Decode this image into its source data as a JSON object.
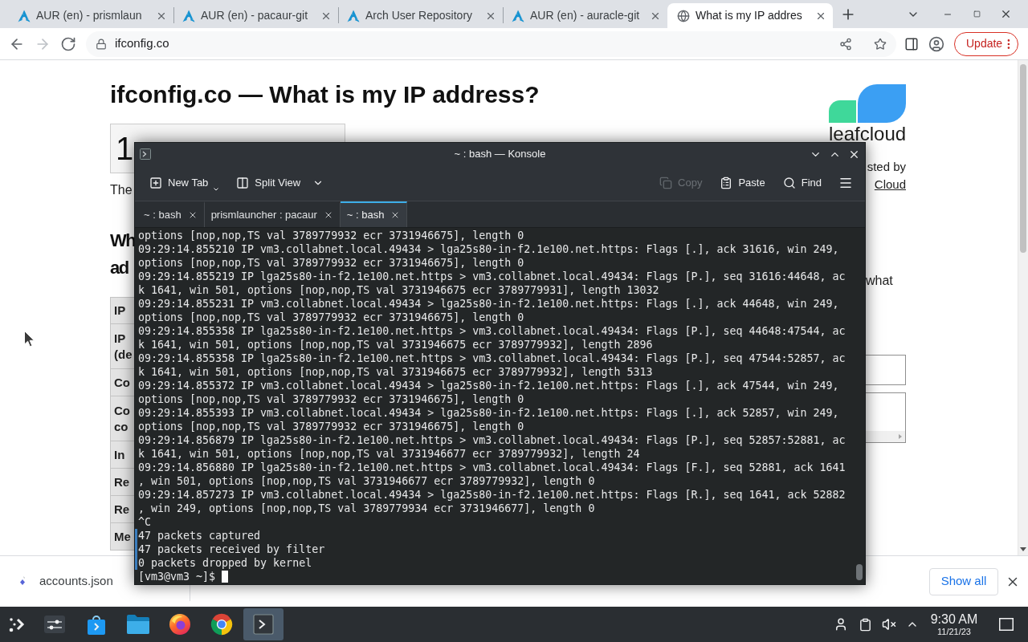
{
  "browser": {
    "tabs": [
      {
        "title": "AUR (en) - prismlaun",
        "kind": "logo",
        "selected": false
      },
      {
        "title": "AUR (en) - pacaur-git",
        "kind": "logo",
        "selected": false
      },
      {
        "title": "Arch User Repository",
        "kind": "logo",
        "selected": false
      },
      {
        "title": "AUR (en) - auracle-git",
        "kind": "logo",
        "selected": false
      },
      {
        "title": "What is my IP addres",
        "kind": "globe",
        "selected": true
      }
    ],
    "nav": [
      {
        "kind": "back",
        "disabled": false
      },
      {
        "kind": "forward",
        "disabled": true
      },
      {
        "kind": "reload",
        "disabled": false
      }
    ],
    "address": "ifconfig.co",
    "update_label": "Update"
  },
  "page": {
    "title": "ifconfig.co — What is my IP address?",
    "ip_address": "1",
    "intro": "The",
    "heading_lines": [
      "Wh",
      "ad"
    ],
    "table_rows": [
      {
        "lines": [
          "IP"
        ]
      },
      {
        "lines": [
          "IP",
          "(de"
        ]
      },
      {
        "lines": [
          "Co"
        ]
      },
      {
        "lines": [
          "Co",
          "co"
        ]
      },
      {
        "lines": [
          "In"
        ]
      },
      {
        "lines": [
          "Re"
        ]
      },
      {
        "lines": [
          "Re"
        ]
      },
      {
        "lines": [
          "Me"
        ]
      }
    ],
    "sponsor": {
      "logo_text": "leafcloud",
      "text": "sted by",
      "link": "Cloud"
    },
    "side_text": "what"
  },
  "downloads": {
    "items": [
      {
        "file": "accounts.json"
      }
    ],
    "show_all": "Show all"
  },
  "konsole": {
    "title": "~ : bash — Konsole",
    "toolbar": [
      {
        "label": "New Tab",
        "kind": "newtab",
        "disabled": false
      },
      {
        "label": "Split View",
        "kind": "split",
        "disabled": false
      },
      {
        "label": "Copy",
        "kind": "copy",
        "disabled": true
      },
      {
        "label": "Paste",
        "kind": "paste",
        "disabled": false
      },
      {
        "label": "Find",
        "kind": "find",
        "disabled": false
      }
    ],
    "tabs": [
      {
        "label": "~ : bash",
        "selected": false
      },
      {
        "label": "prismlauncher : pacaur",
        "selected": false
      },
      {
        "label": "~ : bash",
        "selected": true
      }
    ],
    "lines": [
      {
        "text": "options [nop,nop,TS val 3789779932 ecr 3731946675], length 0",
        "marked": false
      },
      {
        "text": "09:29:14.855210 IP vm3.collabnet.local.49434 > lga25s80-in-f2.1e100.net.https: Flags [.], ack 31616, win 249,",
        "marked": false
      },
      {
        "text": "options [nop,nop,TS val 3789779932 ecr 3731946675], length 0",
        "marked": false
      },
      {
        "text": "09:29:14.855219 IP lga25s80-in-f2.1e100.net.https > vm3.collabnet.local.49434: Flags [P.], seq 31616:44648, ac",
        "marked": false
      },
      {
        "text": "k 1641, win 501, options [nop,nop,TS val 3731946675 ecr 3789779931], length 13032",
        "marked": false
      },
      {
        "text": "09:29:14.855231 IP vm3.collabnet.local.49434 > lga25s80-in-f2.1e100.net.https: Flags [.], ack 44648, win 249,",
        "marked": false
      },
      {
        "text": "options [nop,nop,TS val 3789779932 ecr 3731946675], length 0",
        "marked": false
      },
      {
        "text": "09:29:14.855358 IP lga25s80-in-f2.1e100.net.https > vm3.collabnet.local.49434: Flags [P.], seq 44648:47544, ac",
        "marked": false
      },
      {
        "text": "k 1641, win 501, options [nop,nop,TS val 3731946675 ecr 3789779932], length 2896",
        "marked": false
      },
      {
        "text": "09:29:14.855358 IP lga25s80-in-f2.1e100.net.https > vm3.collabnet.local.49434: Flags [P.], seq 47544:52857, ac",
        "marked": false
      },
      {
        "text": "k 1641, win 501, options [nop,nop,TS val 3731946675 ecr 3789779932], length 5313",
        "marked": false
      },
      {
        "text": "09:29:14.855372 IP vm3.collabnet.local.49434 > lga25s80-in-f2.1e100.net.https: Flags [.], ack 47544, win 249,",
        "marked": false
      },
      {
        "text": "options [nop,nop,TS val 3789779932 ecr 3731946675], length 0",
        "marked": false
      },
      {
        "text": "09:29:14.855393 IP vm3.collabnet.local.49434 > lga25s80-in-f2.1e100.net.https: Flags [.], ack 52857, win 249,",
        "marked": false
      },
      {
        "text": "options [nop,nop,TS val 3789779932 ecr 3731946675], length 0",
        "marked": false
      },
      {
        "text": "09:29:14.856879 IP lga25s80-in-f2.1e100.net.https > vm3.collabnet.local.49434: Flags [P.], seq 52857:52881, ac",
        "marked": false
      },
      {
        "text": "k 1641, win 501, options [nop,nop,TS val 3731946677 ecr 3789779932], length 24",
        "marked": false
      },
      {
        "text": "09:29:14.856880 IP lga25s80-in-f2.1e100.net.https > vm3.collabnet.local.49434: Flags [F.], seq 52881, ack 1641",
        "marked": false
      },
      {
        "text": ", win 501, options [nop,nop,TS val 3731946677 ecr 3789779932], length 0",
        "marked": false
      },
      {
        "text": "09:29:14.857273 IP vm3.collabnet.local.49434 > lga25s80-in-f2.1e100.net.https: Flags [R.], seq 1641, ack 52882",
        "marked": false
      },
      {
        "text": ", win 249, options [nop,nop,TS val 3789779934 ecr 3731946677], length 0",
        "marked": false
      },
      {
        "text": "^C",
        "marked": false
      },
      {
        "text": "47 packets captured",
        "marked": true
      },
      {
        "text": "47 packets received by filter",
        "marked": true
      },
      {
        "text": "0 packets dropped by kernel",
        "marked": true
      }
    ],
    "prompt": "[vm3@vm3 ~]$"
  },
  "taskbar": {
    "apps": [
      {
        "kind": "menu",
        "selected": false
      },
      {
        "kind": "sliders",
        "selected": false
      },
      {
        "kind": "bag",
        "selected": false
      },
      {
        "kind": "folder",
        "selected": false
      },
      {
        "kind": "sphere",
        "selected": false
      },
      {
        "kind": "ring",
        "selected": false
      },
      {
        "kind": "terminal",
        "selected": true
      }
    ],
    "time": "9:30 AM",
    "date": "11/21/23"
  }
}
